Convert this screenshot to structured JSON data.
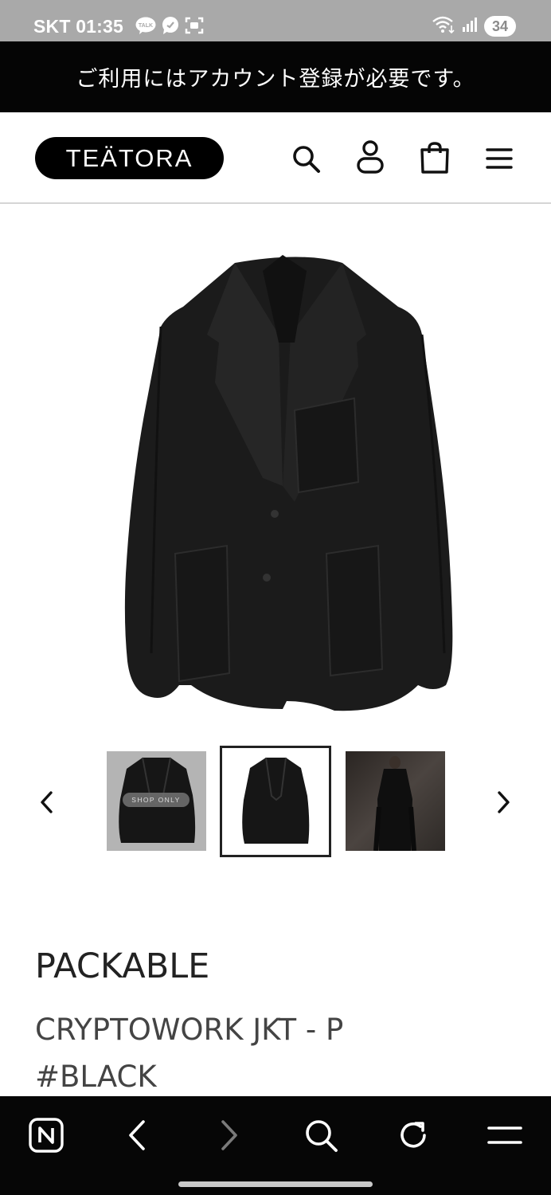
{
  "status_bar": {
    "carrier_time": "SKT 01:35",
    "talk_badge": "TALK",
    "battery": "34"
  },
  "banner": {
    "text": "ご利用にはアカウント登録が必要です。"
  },
  "header": {
    "logo": "TEÄTORA",
    "icons": [
      "search-icon",
      "account-icon",
      "cart-icon",
      "menu-icon"
    ]
  },
  "gallery": {
    "thumbnails": [
      {
        "badge": "SHOP ONLY",
        "selected": false
      },
      {
        "selected": true
      },
      {
        "selected": false
      }
    ]
  },
  "product": {
    "title": "PACKABLE",
    "name_line1": "CRYPTOWORK JKT - P",
    "name_line2": "#BLACK"
  },
  "toolbar": {
    "icons": [
      "naver-home-icon",
      "back-icon",
      "forward-icon",
      "search-icon",
      "refresh-icon",
      "menu-icon"
    ]
  },
  "colors": {
    "banner_bg": "#050505",
    "toolbar_bg": "#060606",
    "status_bar_bg": "#a9a9a9"
  }
}
